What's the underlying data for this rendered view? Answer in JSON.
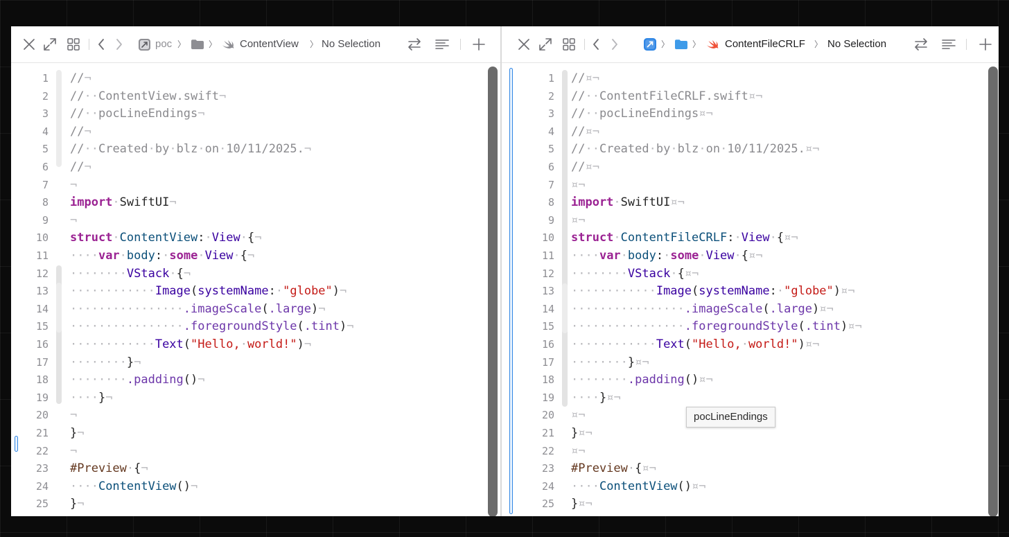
{
  "toolbar_icons": {
    "close": "close-icon",
    "expand": "expand-icon",
    "grid": "grid-icon",
    "back": "chevron-left-icon",
    "forward": "chevron-right-icon",
    "related": "swap-arrows-icon",
    "minimap": "lines-icon",
    "add": "plus-icon"
  },
  "left": {
    "crumbs": [
      "poc",
      "",
      "ContentView",
      "No Selection"
    ],
    "gutter_start": 1,
    "lines": [
      [
        [
          "c",
          "//"
        ],
        [
          "ws",
          "¬"
        ]
      ],
      [
        [
          "c",
          "//"
        ],
        [
          "ws",
          "··"
        ],
        [
          "c",
          "ContentView.swift"
        ],
        [
          "ws",
          "¬"
        ]
      ],
      [
        [
          "c",
          "//"
        ],
        [
          "ws",
          "··"
        ],
        [
          "c",
          "pocLineEndings"
        ],
        [
          "ws",
          "¬"
        ]
      ],
      [
        [
          "c",
          "//"
        ],
        [
          "ws",
          "¬"
        ]
      ],
      [
        [
          "c",
          "//"
        ],
        [
          "ws",
          "··"
        ],
        [
          "c",
          "Created"
        ],
        [
          "ws",
          "·"
        ],
        [
          "c",
          "by"
        ],
        [
          "ws",
          "·"
        ],
        [
          "c",
          "blz"
        ],
        [
          "ws",
          "·"
        ],
        [
          "c",
          "on"
        ],
        [
          "ws",
          "·"
        ],
        [
          "c",
          "10/11/2025."
        ],
        [
          "ws",
          "¬"
        ]
      ],
      [
        [
          "c",
          "//"
        ],
        [
          "ws",
          "¬"
        ]
      ],
      [
        [
          "ws",
          "¬"
        ]
      ],
      [
        [
          "k",
          "import"
        ],
        [
          "ws",
          "·"
        ],
        [
          "n",
          "SwiftUI"
        ],
        [
          "ws",
          "¬"
        ]
      ],
      [
        [
          "ws",
          "¬"
        ]
      ],
      [
        [
          "k",
          "struct"
        ],
        [
          "ws",
          "·"
        ],
        [
          "ty",
          "ContentView"
        ],
        [
          "p",
          ":"
        ],
        [
          "ws",
          "·"
        ],
        [
          "st",
          "View"
        ],
        [
          "ws",
          "·"
        ],
        [
          "p",
          "{"
        ],
        [
          "ws",
          "¬"
        ]
      ],
      [
        [
          "ws",
          "····"
        ],
        [
          "k",
          "var"
        ],
        [
          "ws",
          "·"
        ],
        [
          "ty",
          "body"
        ],
        [
          "p",
          ":"
        ],
        [
          "ws",
          "·"
        ],
        [
          "k",
          "some"
        ],
        [
          "ws",
          "·"
        ],
        [
          "st",
          "View"
        ],
        [
          "ws",
          "·"
        ],
        [
          "p",
          "{"
        ],
        [
          "ws",
          "¬"
        ]
      ],
      [
        [
          "ws",
          "········"
        ],
        [
          "st",
          "VStack"
        ],
        [
          "ws",
          "·"
        ],
        [
          "p",
          "{"
        ],
        [
          "ws",
          "¬"
        ]
      ],
      [
        [
          "ws",
          "············"
        ],
        [
          "st",
          "Image"
        ],
        [
          "p",
          "("
        ],
        [
          "st",
          "systemName"
        ],
        [
          "p",
          ":"
        ],
        [
          "ws",
          "·"
        ],
        [
          "s",
          "\"globe\""
        ],
        [
          "p",
          ")"
        ],
        [
          "ws",
          "¬"
        ]
      ],
      [
        [
          "ws",
          "················"
        ],
        [
          "m",
          ".imageScale"
        ],
        [
          "p",
          "("
        ],
        [
          "m",
          ".large"
        ],
        [
          "p",
          ")"
        ],
        [
          "ws",
          "¬"
        ]
      ],
      [
        [
          "ws",
          "················"
        ],
        [
          "m",
          ".foregroundStyle"
        ],
        [
          "p",
          "("
        ],
        [
          "m",
          ".tint"
        ],
        [
          "p",
          ")"
        ],
        [
          "ws",
          "¬"
        ]
      ],
      [
        [
          "ws",
          "············"
        ],
        [
          "st",
          "Text"
        ],
        [
          "p",
          "("
        ],
        [
          "s",
          "\"Hello,"
        ],
        [
          "ws",
          "·"
        ],
        [
          "s",
          "world!\""
        ],
        [
          "p",
          ")"
        ],
        [
          "ws",
          "¬"
        ]
      ],
      [
        [
          "ws",
          "········"
        ],
        [
          "p",
          "}"
        ],
        [
          "ws",
          "¬"
        ]
      ],
      [
        [
          "ws",
          "········"
        ],
        [
          "m",
          ".padding"
        ],
        [
          "p",
          "()"
        ],
        [
          "ws",
          "¬"
        ]
      ],
      [
        [
          "ws",
          "····"
        ],
        [
          "p",
          "}"
        ],
        [
          "ws",
          "¬"
        ]
      ],
      [
        [
          "ws",
          "¬"
        ]
      ],
      [
        [
          "p",
          "}"
        ],
        [
          "ws",
          "¬"
        ]
      ],
      [
        [
          "ws",
          "¬"
        ]
      ],
      [
        [
          "d",
          "#Preview"
        ],
        [
          "ws",
          "·"
        ],
        [
          "p",
          "{"
        ],
        [
          "ws",
          "¬"
        ]
      ],
      [
        [
          "ws",
          "····"
        ],
        [
          "ty",
          "ContentView"
        ],
        [
          "p",
          "()"
        ],
        [
          "ws",
          "¬"
        ]
      ],
      [
        [
          "p",
          "}"
        ],
        [
          "ws",
          "¬"
        ]
      ]
    ]
  },
  "right": {
    "crumbs": [
      "",
      "",
      "ContentFileCRLF",
      "No Selection"
    ],
    "gutter_start": 1,
    "lines": [
      [
        [
          "c",
          "//"
        ],
        [
          "ws",
          "¤¬"
        ]
      ],
      [
        [
          "c",
          "//"
        ],
        [
          "ws",
          "··"
        ],
        [
          "c",
          "ContentFileCRLF.swift"
        ],
        [
          "ws",
          "¤¬"
        ]
      ],
      [
        [
          "c",
          "//"
        ],
        [
          "ws",
          "··"
        ],
        [
          "c",
          "pocLineEndings"
        ],
        [
          "ws",
          "¤¬"
        ]
      ],
      [
        [
          "c",
          "//"
        ],
        [
          "ws",
          "¤¬"
        ]
      ],
      [
        [
          "c",
          "//"
        ],
        [
          "ws",
          "··"
        ],
        [
          "c",
          "Created"
        ],
        [
          "ws",
          "·"
        ],
        [
          "c",
          "by"
        ],
        [
          "ws",
          "·"
        ],
        [
          "c",
          "blz"
        ],
        [
          "ws",
          "·"
        ],
        [
          "c",
          "on"
        ],
        [
          "ws",
          "·"
        ],
        [
          "c",
          "10/11/2025."
        ],
        [
          "ws",
          "¤¬"
        ]
      ],
      [
        [
          "c",
          "//"
        ],
        [
          "ws",
          "¤¬"
        ]
      ],
      [
        [
          "ws",
          "¤¬"
        ]
      ],
      [
        [
          "k",
          "import"
        ],
        [
          "ws",
          "·"
        ],
        [
          "n",
          "SwiftUI"
        ],
        [
          "ws",
          "¤¬"
        ]
      ],
      [
        [
          "ws",
          "¤¬"
        ]
      ],
      [
        [
          "k",
          "struct"
        ],
        [
          "ws",
          "·"
        ],
        [
          "ty",
          "ContentFileCRLF"
        ],
        [
          "p",
          ":"
        ],
        [
          "ws",
          "·"
        ],
        [
          "st",
          "View"
        ],
        [
          "ws",
          "·"
        ],
        [
          "p",
          "{"
        ],
        [
          "ws",
          "¤¬"
        ]
      ],
      [
        [
          "ws",
          "····"
        ],
        [
          "k",
          "var"
        ],
        [
          "ws",
          "·"
        ],
        [
          "ty",
          "body"
        ],
        [
          "p",
          ":"
        ],
        [
          "ws",
          "·"
        ],
        [
          "k",
          "some"
        ],
        [
          "ws",
          "·"
        ],
        [
          "st",
          "View"
        ],
        [
          "ws",
          "·"
        ],
        [
          "p",
          "{"
        ],
        [
          "ws",
          "¤¬"
        ]
      ],
      [
        [
          "ws",
          "········"
        ],
        [
          "st",
          "VStack"
        ],
        [
          "ws",
          "·"
        ],
        [
          "p",
          "{"
        ],
        [
          "ws",
          "¤¬"
        ]
      ],
      [
        [
          "ws",
          "············"
        ],
        [
          "st",
          "Image"
        ],
        [
          "p",
          "("
        ],
        [
          "st",
          "systemName"
        ],
        [
          "p",
          ":"
        ],
        [
          "ws",
          "·"
        ],
        [
          "s",
          "\"globe\""
        ],
        [
          "p",
          ")"
        ],
        [
          "ws",
          "¤¬"
        ]
      ],
      [
        [
          "ws",
          "················"
        ],
        [
          "m",
          ".imageScale"
        ],
        [
          "p",
          "("
        ],
        [
          "m",
          ".large"
        ],
        [
          "p",
          ")"
        ],
        [
          "ws",
          "¤¬"
        ]
      ],
      [
        [
          "ws",
          "················"
        ],
        [
          "m",
          ".foregroundStyle"
        ],
        [
          "p",
          "("
        ],
        [
          "m",
          ".tint"
        ],
        [
          "p",
          ")"
        ],
        [
          "ws",
          "¤¬"
        ]
      ],
      [
        [
          "ws",
          "············"
        ],
        [
          "st",
          "Text"
        ],
        [
          "p",
          "("
        ],
        [
          "s",
          "\"Hello,"
        ],
        [
          "ws",
          "·"
        ],
        [
          "s",
          "world!\""
        ],
        [
          "p",
          ")"
        ],
        [
          "ws",
          "¤¬"
        ]
      ],
      [
        [
          "ws",
          "········"
        ],
        [
          "p",
          "}"
        ],
        [
          "ws",
          "¤¬"
        ]
      ],
      [
        [
          "ws",
          "········"
        ],
        [
          "m",
          ".padding"
        ],
        [
          "p",
          "()"
        ],
        [
          "ws",
          "¤¬"
        ]
      ],
      [
        [
          "ws",
          "····"
        ],
        [
          "p",
          "}"
        ],
        [
          "ws",
          "¤¬"
        ]
      ],
      [
        [
          "ws",
          "¤¬"
        ]
      ],
      [
        [
          "p",
          "}"
        ],
        [
          "ws",
          "¤¬"
        ]
      ],
      [
        [
          "ws",
          "¤¬"
        ]
      ],
      [
        [
          "d",
          "#Preview"
        ],
        [
          "ws",
          "·"
        ],
        [
          "p",
          "{"
        ],
        [
          "ws",
          "¤¬"
        ]
      ],
      [
        [
          "ws",
          "····"
        ],
        [
          "ty",
          "ContentView"
        ],
        [
          "p",
          "()"
        ],
        [
          "ws",
          "¤¬"
        ]
      ],
      [
        [
          "p",
          "}"
        ],
        [
          "ws",
          "¤¬"
        ]
      ]
    ]
  },
  "tooltip": "pocLineEndings",
  "colors": {
    "keyword": "#9b2393",
    "type": "#0b4f79",
    "system_type": "#3900a0",
    "string": "#c41a16",
    "method": "#6c36a9",
    "comment": "#8a8a8e",
    "invisible": "#b9b9bd",
    "swift_orange": "#f05138",
    "folder_blue": "#3e9be9",
    "accent_blue": "#2f86e5"
  }
}
